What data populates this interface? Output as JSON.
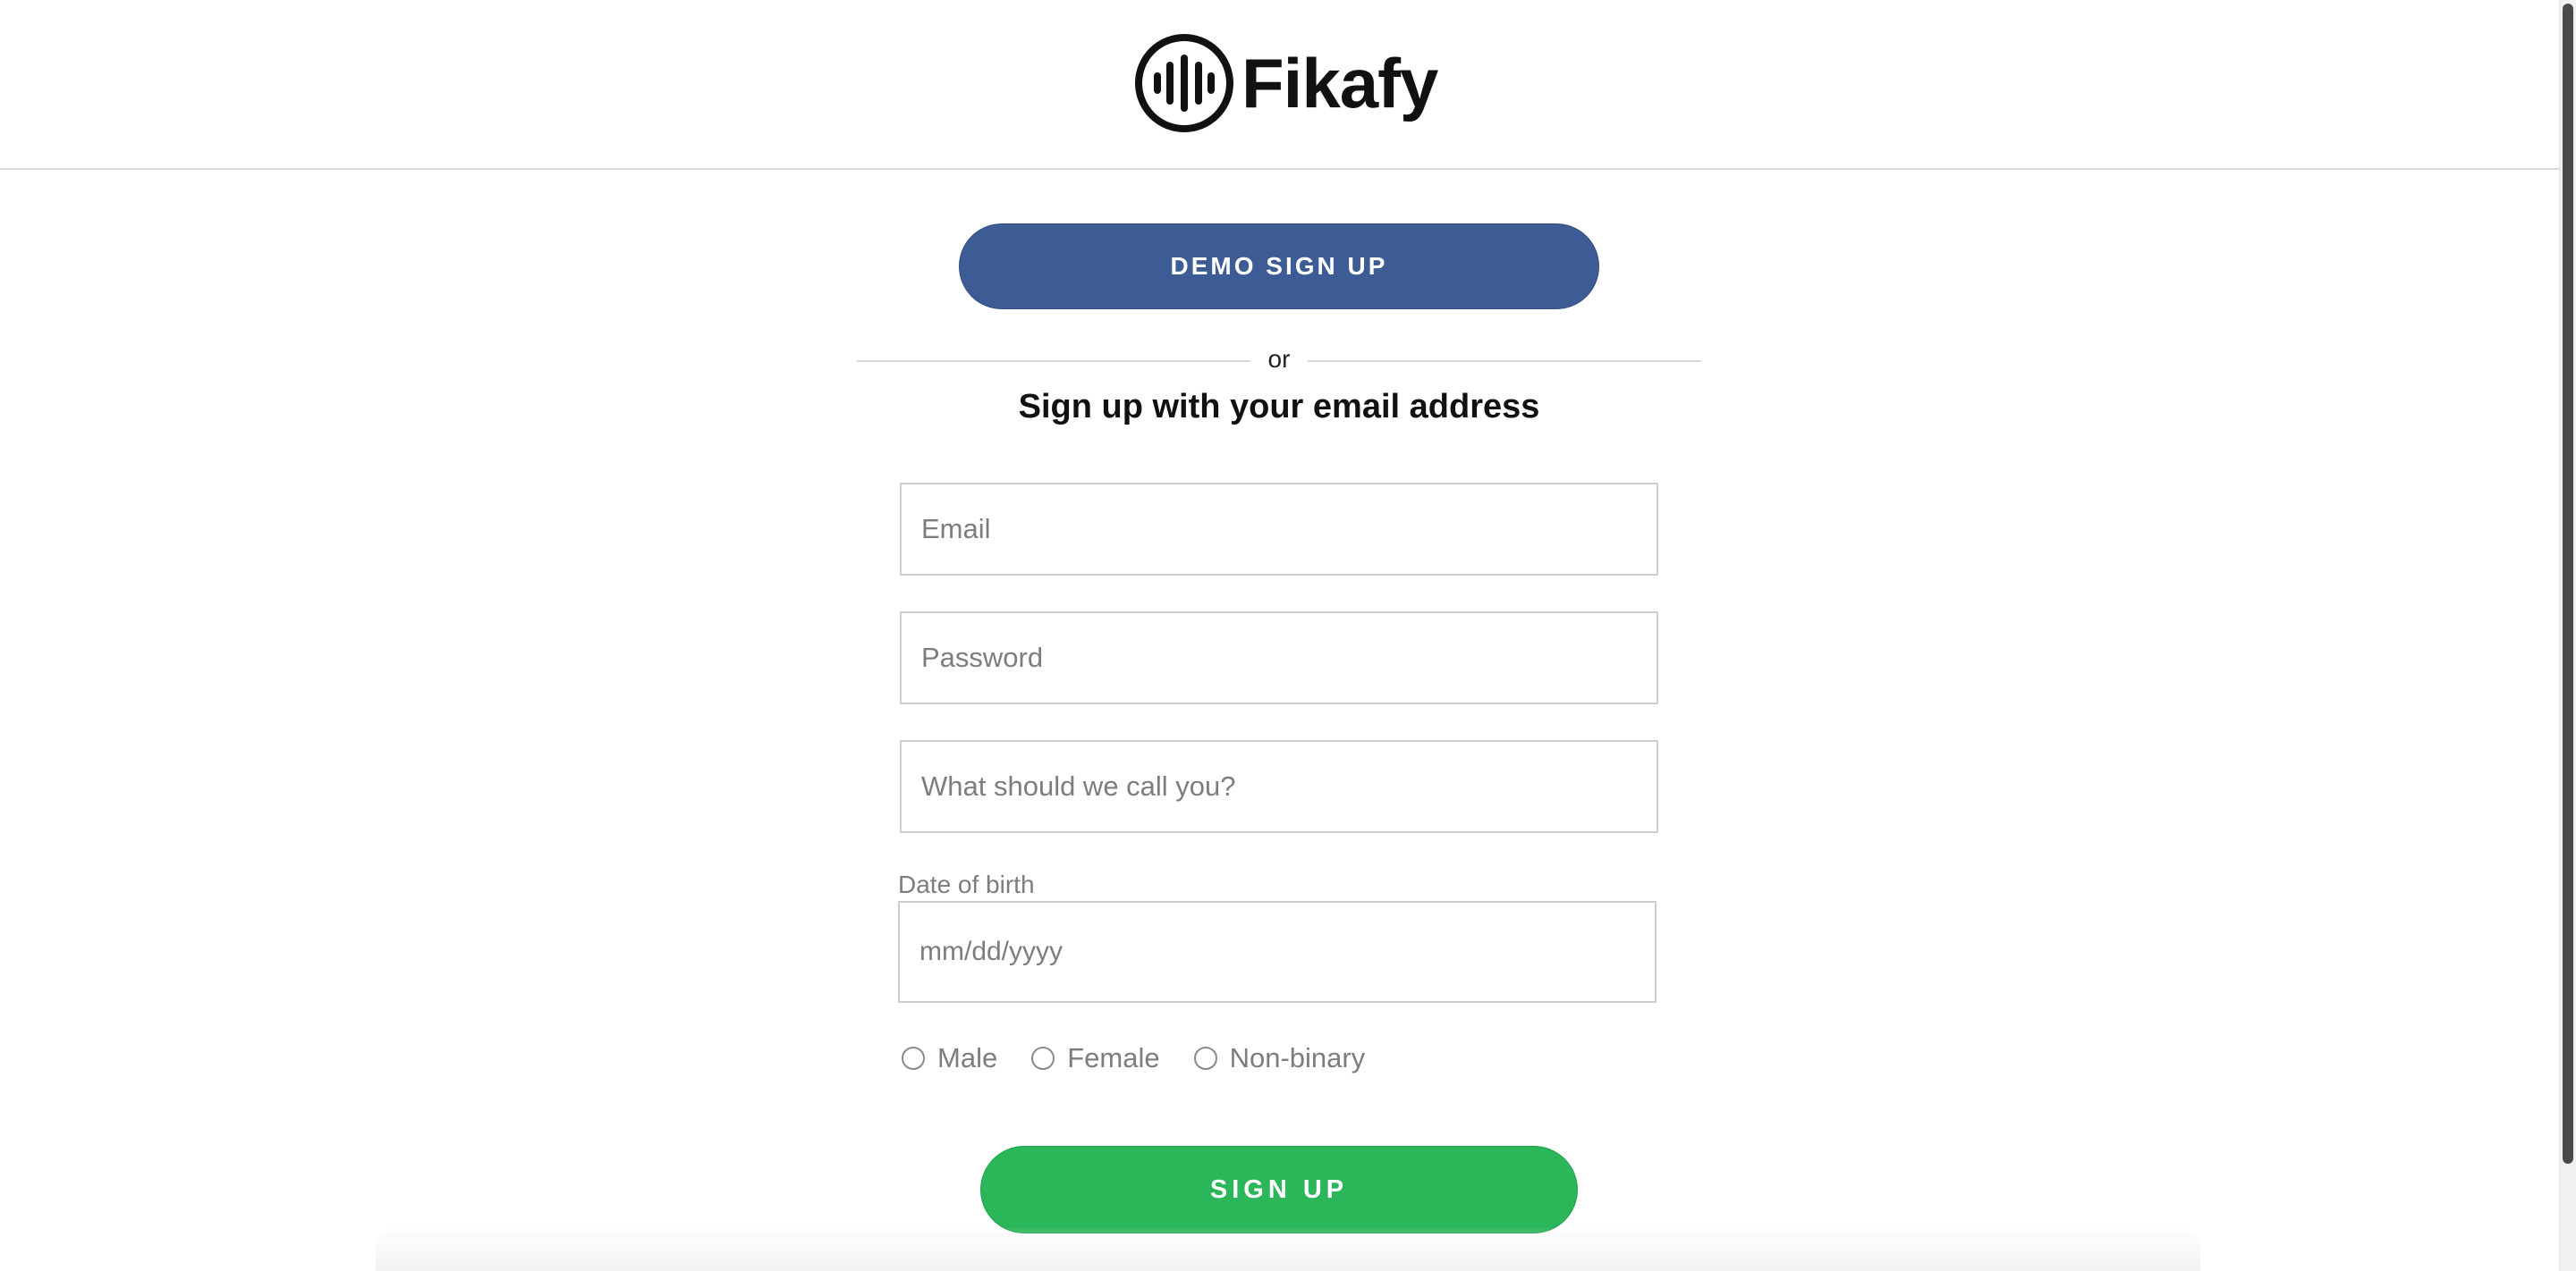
{
  "header": {
    "logo_text": "Fikafy",
    "logo_icon": "soundwave-circle-icon"
  },
  "demo_button": {
    "label": "DEMO SIGN UP",
    "color": "#3d5b94"
  },
  "divider": {
    "text": "or"
  },
  "form": {
    "title": "Sign up with your email address",
    "email": {
      "placeholder": "Email",
      "value": ""
    },
    "password": {
      "placeholder": "Password",
      "value": ""
    },
    "name": {
      "placeholder": "What should we call you?",
      "value": ""
    },
    "dob": {
      "label": "Date of birth",
      "placeholder": "mm/dd/yyyy"
    },
    "gender_options": [
      {
        "label": "Male",
        "selected": false
      },
      {
        "label": "Female",
        "selected": false
      },
      {
        "label": "Non-binary",
        "selected": false
      }
    ],
    "submit_label": "SIGN UP",
    "submit_color": "#2bb65a"
  }
}
